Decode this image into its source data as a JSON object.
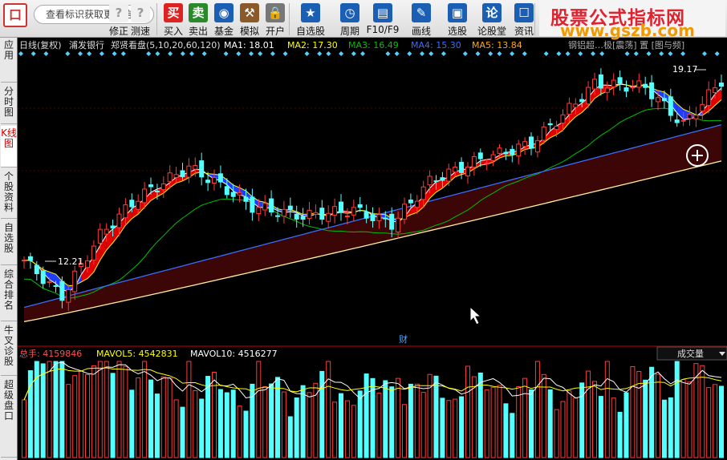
{
  "toolbar": {
    "search_placeholder": "查看标识获取更多信息",
    "buttons": [
      {
        "label": "修正",
        "icon": "?"
      },
      {
        "label": "测速",
        "icon": "?"
      },
      {
        "label": "买入",
        "icon": "买"
      },
      {
        "label": "卖出",
        "icon": "卖"
      },
      {
        "label": "基金",
        "icon": "◉"
      },
      {
        "label": "模拟",
        "icon": "⚒"
      },
      {
        "label": "开户",
        "icon": "🔒"
      },
      {
        "label": "自选股",
        "icon": "★"
      },
      {
        "label": "周期",
        "icon": "◷"
      },
      {
        "label": "F10/F9",
        "icon": "▤"
      },
      {
        "label": "画线",
        "icon": "✎"
      },
      {
        "label": "选股",
        "icon": "▣"
      },
      {
        "label": "论股堂",
        "icon": "论"
      },
      {
        "label": "资讯",
        "icon": "☐"
      }
    ],
    "banner_line1": "股票公式指标网",
    "banner_line2": "www.gszb.com"
  },
  "sidebar": {
    "tabs": [
      {
        "label": "应用",
        "active": false
      },
      {
        "label": "分时图",
        "active": false
      },
      {
        "label": "K线图",
        "active": true
      },
      {
        "label": "个股资料",
        "active": false
      },
      {
        "label": "自选股",
        "active": false
      },
      {
        "label": "综合排名",
        "active": false
      },
      {
        "label": "牛叉诊股",
        "active": false
      },
      {
        "label": "超级盘口",
        "active": false
      }
    ]
  },
  "chart_header": {
    "period": "日线(复权)",
    "stock": "浦发银行",
    "indicator": "郑贤看盘(5,10,20,60,120)",
    "ma1": "MA1: 18.01",
    "ma2": "MA2: 17.30",
    "ma3": "MA3: 16.49",
    "ma4": "MA4: 15.30",
    "ma5": "MA5: 13.84",
    "right_text": "钢铝超…极[震荡] 置 [图与频]"
  },
  "annotations": {
    "high": "19.17",
    "low": "12.21",
    "finance_marker": "财"
  },
  "volume_header": {
    "total": "总手: 4159846",
    "mavol5": "MAVOL5: 4542831",
    "mavol10": "MAVOL10: 4516277",
    "dropdown": "成交量"
  },
  "colors": {
    "up": "#ff3a3a",
    "down": "#54ffff",
    "ma1": "#ffffff",
    "ma2": "#ffff00",
    "ma3": "#00c000",
    "ma4": "#3a6cff",
    "ma5": "#fff0a0",
    "band_fill": "#3c0606"
  },
  "chart_data": {
    "type": "candlestick",
    "ma_periods": [
      5,
      10,
      20,
      60,
      120
    ],
    "price_range": [
      12.21,
      19.17
    ],
    "volume_range": [
      0,
      8000000
    ]
  }
}
